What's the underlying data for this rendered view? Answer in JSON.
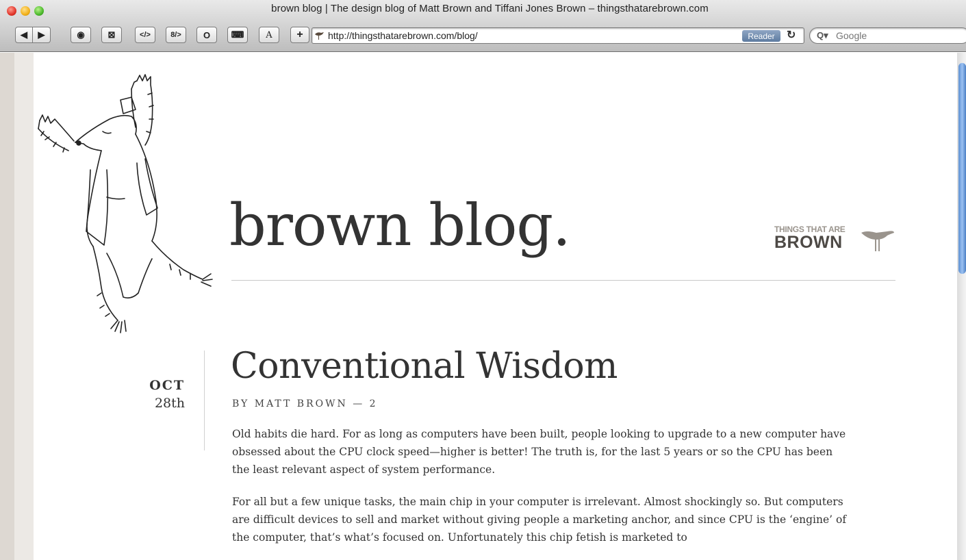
{
  "window": {
    "title": "brown blog | The design blog of Matt Brown and Tiffani Jones Brown – thingsthatarebrown.com"
  },
  "toolbar": {
    "back_label": "◀",
    "forward_label": "▶",
    "record_label": "◉",
    "mail_label": "⊠",
    "source_label": "</>",
    "edit_source_label": "8/>",
    "circle_label": "O",
    "keyboard_label": "⌨",
    "font_label": "A",
    "add_label": "+",
    "url": "http://thingsthatarebrown.com/blog/",
    "reader_label": "Reader",
    "reload_label": "↻",
    "search_placeholder": "Google"
  },
  "blog": {
    "title": "brown blog.",
    "logo_small": "THINGS THAT ARE",
    "logo_big": "BROWN"
  },
  "post": {
    "month": "OCT",
    "day": "28th",
    "title": "Conventional Wisdom",
    "byline": "BY MATT BROWN — 2",
    "paragraphs": [
      "Old habits die hard. For as long as computers have been built, people looking to upgrade to a new computer have obsessed about the CPU clock speed—higher is better! The truth is, for the last 5 years or so the CPU has been the least relevant aspect of system performance.",
      "For all but a few unique tasks, the main chip in your computer is irrelevant. Almost shockingly so. But computers are difficult devices to sell and market without giving people a marketing anchor, and since CPU is the ‘engine’ of the computer, that’s what’s focused on. Unfortunately this chip fetish is marketed to"
    ]
  },
  "colors": {
    "text": "#333333",
    "strip": "#ece9e5",
    "logo_grey": "#9a948d",
    "logo_dark": "#4d4945"
  }
}
